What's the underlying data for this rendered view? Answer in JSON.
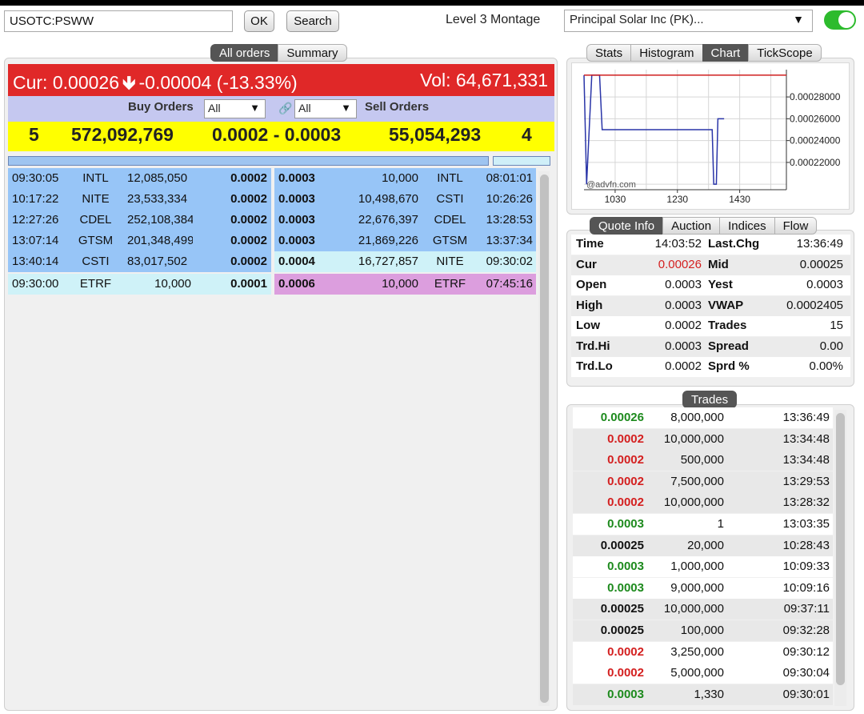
{
  "header": {
    "symbol_value": "USOTC:PSWW",
    "ok_label": "OK",
    "search_label": "Search",
    "montage_label": "Level 3 Montage",
    "company_selected": "Principal Solar Inc (PK)...",
    "toggle_on": true
  },
  "main_tabs": [
    "All orders",
    "Summary"
  ],
  "cur_bar": {
    "cur_label": "Cur: 0.00026",
    "change": "-0.00004 (-13.33%)",
    "vol": "Vol: 64,671,331"
  },
  "orders_header": {
    "buy_label": "Buy Orders",
    "buy_filter": "All",
    "sell_filter": "All",
    "sell_label": "Sell Orders"
  },
  "summary": {
    "buy_count": "5",
    "buy_volume": "572,092,769",
    "spread": "0.0002 - 0.0003",
    "sell_volume": "55,054,293",
    "sell_count": "4"
  },
  "buy_orders": [
    {
      "time": "09:30:05",
      "mm": "INTL",
      "size": "12,085,050",
      "price": "0.0002",
      "bg": "blue"
    },
    {
      "time": "10:17:22",
      "mm": "NITE",
      "size": "23,533,334",
      "price": "0.0002",
      "bg": "blue"
    },
    {
      "time": "12:27:26",
      "mm": "CDEL",
      "size": "252,108,384",
      "price": "0.0002",
      "bg": "blue"
    },
    {
      "time": "13:07:14",
      "mm": "GTSM",
      "size": "201,348,499",
      "price": "0.0002",
      "bg": "blue"
    },
    {
      "time": "13:40:14",
      "mm": "CSTI",
      "size": "83,017,502",
      "price": "0.0002",
      "bg": "blue"
    },
    {
      "time": "09:30:00",
      "mm": "ETRF",
      "size": "10,000",
      "price": "0.0001",
      "bg": "cyan"
    }
  ],
  "sell_orders": [
    {
      "price": "0.0003",
      "size": "10,000",
      "mm": "INTL",
      "time": "08:01:01",
      "bg": "blue"
    },
    {
      "price": "0.0003",
      "size": "10,498,670",
      "mm": "CSTI",
      "time": "10:26:26",
      "bg": "blue"
    },
    {
      "price": "0.0003",
      "size": "22,676,397",
      "mm": "CDEL",
      "time": "13:28:53",
      "bg": "blue"
    },
    {
      "price": "0.0003",
      "size": "21,869,226",
      "mm": "GTSM",
      "time": "13:37:34",
      "bg": "blue"
    },
    {
      "price": "0.0004",
      "size": "16,727,857",
      "mm": "NITE",
      "time": "09:30:02",
      "bg": "cyan"
    },
    {
      "price": "0.0006",
      "size": "10,000",
      "mm": "ETRF",
      "time": "07:45:16",
      "bg": "pink"
    }
  ],
  "chart_tabs": [
    "Stats",
    "Histogram",
    "Chart",
    "TickScope"
  ],
  "chart_active": "Chart",
  "chart_data": {
    "type": "line",
    "xticks": [
      "1030",
      "1230",
      "1430"
    ],
    "yticks": [
      "0.00028000",
      "0.00026000",
      "0.00024000",
      "0.00022000"
    ],
    "watermark": "@advfn.com",
    "series": [
      {
        "color": "#2a35a8",
        "points": [
          [
            930,
            0.0003
          ],
          [
            935,
            0.0002
          ],
          [
            945,
            0.0003
          ],
          [
            1000,
            0.0003
          ],
          [
            1005,
            0.00025
          ],
          [
            1337,
            0.00025
          ],
          [
            1340,
            0.0002
          ],
          [
            1345,
            0.0002
          ],
          [
            1348,
            0.00026
          ],
          [
            1400,
            0.00026
          ]
        ]
      },
      {
        "color": "#d02020",
        "points": [
          [
            930,
            0.0003
          ],
          [
            1600,
            0.0003
          ]
        ]
      }
    ],
    "xlim": [
      930,
      1600
    ],
    "ylim": [
      0.000195,
      0.000305
    ]
  },
  "quote_tabs": [
    "Quote Info",
    "Auction",
    "Indices",
    "Flow"
  ],
  "quote_active": "Quote Info",
  "quote_rows": [
    {
      "l1": "Time",
      "v1": "14:03:52",
      "l2": "Last.Chg",
      "v2": "13:36:49",
      "v1_color": "normal"
    },
    {
      "l1": "Cur",
      "v1": "0.00026",
      "l2": "Mid",
      "v2": "0.00025",
      "v1_color": "red"
    },
    {
      "l1": "Open",
      "v1": "0.0003",
      "l2": "Yest",
      "v2": "0.0003",
      "v1_color": "normal"
    },
    {
      "l1": "High",
      "v1": "0.0003",
      "l2": "VWAP",
      "v2": "0.0002405",
      "v1_color": "normal"
    },
    {
      "l1": "Low",
      "v1": "0.0002",
      "l2": "Trades",
      "v2": "15",
      "v1_color": "normal"
    },
    {
      "l1": "Trd.Hi",
      "v1": "0.0003",
      "l2": "Spread",
      "v2": "0.00",
      "v1_color": "normal"
    },
    {
      "l1": "Trd.Lo",
      "v1": "0.0002",
      "l2": "Sprd %",
      "v2": "0.00%",
      "v1_color": "normal"
    }
  ],
  "trades_label": "Trades",
  "trades": [
    {
      "price": "0.00026",
      "size": "8,000,000",
      "time": "13:36:49",
      "color": "green",
      "bg": "white"
    },
    {
      "price": "0.0002",
      "size": "10,000,000",
      "time": "13:34:48",
      "color": "red",
      "bg": "grey"
    },
    {
      "price": "0.0002",
      "size": "500,000",
      "time": "13:34:48",
      "color": "red",
      "bg": "grey"
    },
    {
      "price": "0.0002",
      "size": "7,500,000",
      "time": "13:29:53",
      "color": "red",
      "bg": "grey"
    },
    {
      "price": "0.0002",
      "size": "10,000,000",
      "time": "13:28:32",
      "color": "red",
      "bg": "grey"
    },
    {
      "price": "0.0003",
      "size": "1",
      "time": "13:03:35",
      "color": "green",
      "bg": "white"
    },
    {
      "price": "0.00025",
      "size": "20,000",
      "time": "10:28:43",
      "color": "black",
      "bg": "grey"
    },
    {
      "price": "0.0003",
      "size": "1,000,000",
      "time": "10:09:33",
      "color": "green",
      "bg": "white"
    },
    {
      "price": "0.0003",
      "size": "9,000,000",
      "time": "10:09:16",
      "color": "green",
      "bg": "white"
    },
    {
      "price": "0.00025",
      "size": "10,000,000",
      "time": "09:37:11",
      "color": "black",
      "bg": "grey"
    },
    {
      "price": "0.00025",
      "size": "100,000",
      "time": "09:32:28",
      "color": "black",
      "bg": "grey"
    },
    {
      "price": "0.0002",
      "size": "3,250,000",
      "time": "09:30:12",
      "color": "red",
      "bg": "white"
    },
    {
      "price": "0.0002",
      "size": "5,000,000",
      "time": "09:30:04",
      "color": "red",
      "bg": "white"
    },
    {
      "price": "0.0003",
      "size": "1,330",
      "time": "09:30:01",
      "color": "green",
      "bg": "grey"
    }
  ]
}
